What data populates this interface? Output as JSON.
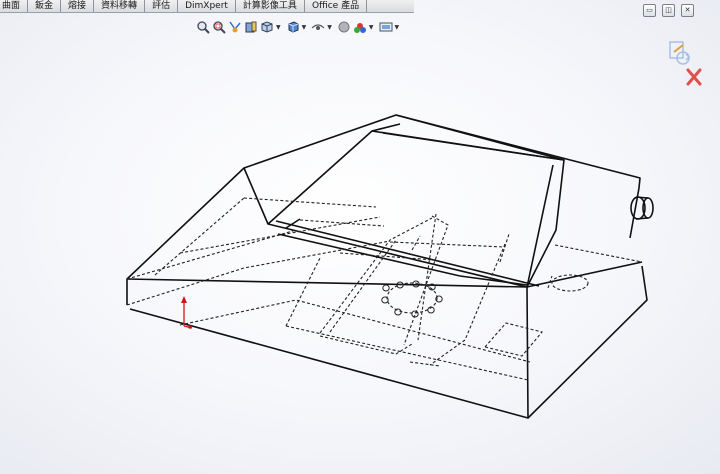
{
  "command_manager": {
    "tabs": [
      {
        "label": "曲面"
      },
      {
        "label": "鈑金"
      },
      {
        "label": "熔接"
      },
      {
        "label": "資料移轉"
      },
      {
        "label": "評估"
      },
      {
        "label": "DimXpert"
      },
      {
        "label": "計算影像工具"
      },
      {
        "label": "Office 產品"
      }
    ]
  },
  "heads_up_toolbar": {
    "icons": [
      "zoom-to-fit-icon",
      "zoom-to-area-icon",
      "previous-view-icon",
      "section-view-icon",
      "view-orientation-icon",
      "display-style-icon",
      "hide-show-items-icon",
      "edit-appearance-icon",
      "apply-scene-icon",
      "view-settings-icon"
    ]
  },
  "window_controls": [
    "restore-icon",
    "tile-icon",
    "close-icon"
  ],
  "confirmation_corner": [
    "rebuild-icon",
    "cancel-icon"
  ],
  "colors": {
    "edge": "#111111",
    "triad_x": "#d01414",
    "triad_y": "#d01414",
    "cancel": "#e0504a",
    "accent": "#4a7fd0"
  }
}
